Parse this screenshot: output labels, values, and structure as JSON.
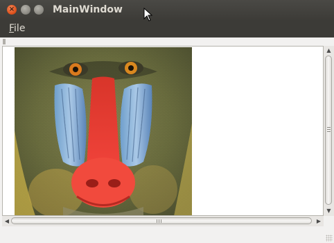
{
  "window": {
    "title": "MainWindow",
    "buttons": {
      "close_glyph": "×",
      "min_glyph": "–",
      "max_glyph": "□"
    }
  },
  "menubar": {
    "items": [
      {
        "mnemonic": "F",
        "rest": "ile"
      }
    ]
  },
  "content": {
    "image_icon": "mandrill-image"
  },
  "scrollbars": {
    "up_arrow": "▲",
    "down_arrow": "▼",
    "left_arrow": "◀",
    "right_arrow": "▶"
  }
}
